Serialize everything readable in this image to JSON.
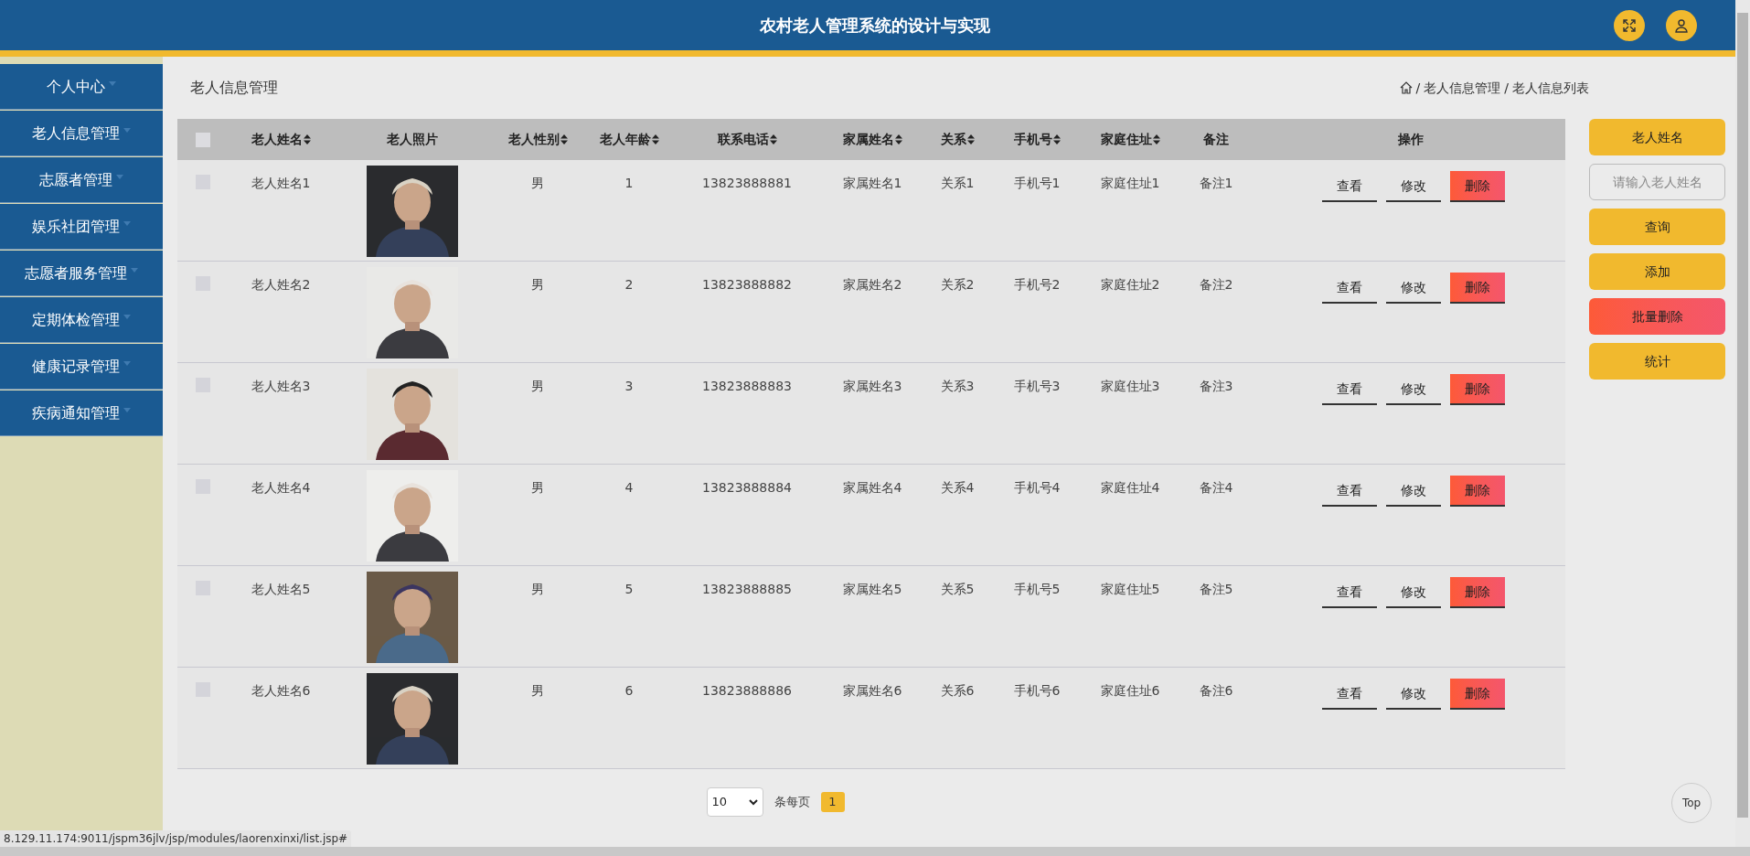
{
  "header": {
    "title": "农村老人管理系统的设计与实现"
  },
  "sidebar": {
    "items": [
      {
        "label": "个人中心"
      },
      {
        "label": "老人信息管理"
      },
      {
        "label": "志愿者管理"
      },
      {
        "label": "娱乐社团管理"
      },
      {
        "label": "志愿者服务管理"
      },
      {
        "label": "定期体检管理"
      },
      {
        "label": "健康记录管理"
      },
      {
        "label": "疾病通知管理"
      }
    ]
  },
  "page_title": "老人信息管理",
  "breadcrumb": [
    {
      "separator": "/",
      "label": "老人信息管理"
    },
    {
      "separator": "/",
      "label": "老人信息列表"
    }
  ],
  "table": {
    "all_checked": false,
    "columns": [
      {
        "label": "老人姓名",
        "sortable": true
      },
      {
        "label": "老人照片",
        "sortable": false
      },
      {
        "label": "老人性别",
        "sortable": true
      },
      {
        "label": "老人年龄",
        "sortable": true
      },
      {
        "label": "联系电话",
        "sortable": true
      },
      {
        "label": "家属姓名",
        "sortable": true
      },
      {
        "label": "关系",
        "sortable": true
      },
      {
        "label": "手机号",
        "sortable": true
      },
      {
        "label": "家庭住址",
        "sortable": true
      },
      {
        "label": "备注",
        "sortable": false
      },
      {
        "label": "操作",
        "sortable": false
      }
    ],
    "rows": [
      {
        "checked": false,
        "name": "老人姓名1",
        "photo": {
          "kind": "picture"
        },
        "gender": "男",
        "age": "1",
        "phone": "13823888881",
        "family": "家属姓名1",
        "relation": "关系1",
        "mobile": "手机号1",
        "address": "家庭住址1",
        "note": "备注1",
        "actions": [
          {
            "label": "查看",
            "kind": "plain"
          },
          {
            "label": "修改",
            "kind": "plain"
          },
          {
            "label": "删除",
            "kind": "danger"
          }
        ]
      },
      {
        "checked": false,
        "name": "老人姓名2",
        "photo": {
          "kind": "picture"
        },
        "gender": "男",
        "age": "2",
        "phone": "13823888882",
        "family": "家属姓名2",
        "relation": "关系2",
        "mobile": "手机号2",
        "address": "家庭住址2",
        "note": "备注2",
        "actions": [
          {
            "label": "查看",
            "kind": "plain"
          },
          {
            "label": "修改",
            "kind": "plain"
          },
          {
            "label": "删除",
            "kind": "danger"
          }
        ]
      },
      {
        "checked": false,
        "name": "老人姓名3",
        "photo": {
          "kind": "picture"
        },
        "gender": "男",
        "age": "3",
        "phone": "13823888883",
        "family": "家属姓名3",
        "relation": "关系3",
        "mobile": "手机号3",
        "address": "家庭住址3",
        "note": "备注3",
        "actions": [
          {
            "label": "查看",
            "kind": "plain"
          },
          {
            "label": "修改",
            "kind": "plain"
          },
          {
            "label": "删除",
            "kind": "danger"
          }
        ]
      },
      {
        "checked": false,
        "name": "老人姓名4",
        "photo": {
          "kind": "picture"
        },
        "gender": "男",
        "age": "4",
        "phone": "13823888884",
        "family": "家属姓名4",
        "relation": "关系4",
        "mobile": "手机号4",
        "address": "家庭住址4",
        "note": "备注4",
        "actions": [
          {
            "label": "查看",
            "kind": "plain"
          },
          {
            "label": "修改",
            "kind": "plain"
          },
          {
            "label": "删除",
            "kind": "danger"
          }
        ]
      },
      {
        "checked": false,
        "name": "老人姓名5",
        "photo": {
          "kind": "picture"
        },
        "gender": "男",
        "age": "5",
        "phone": "13823888885",
        "family": "家属姓名5",
        "relation": "关系5",
        "mobile": "手机号5",
        "address": "家庭住址5",
        "note": "备注5",
        "actions": [
          {
            "label": "查看",
            "kind": "plain"
          },
          {
            "label": "修改",
            "kind": "plain"
          },
          {
            "label": "删除",
            "kind": "danger"
          }
        ]
      },
      {
        "checked": false,
        "name": "老人姓名6",
        "photo": {
          "kind": "picture"
        },
        "gender": "男",
        "age": "6",
        "phone": "13823888886",
        "family": "家属姓名6",
        "relation": "关系6",
        "mobile": "手机号6",
        "address": "家庭住址6",
        "note": "备注6",
        "actions": [
          {
            "label": "查看",
            "kind": "plain"
          },
          {
            "label": "修改",
            "kind": "plain"
          },
          {
            "label": "删除",
            "kind": "danger"
          }
        ]
      }
    ]
  },
  "search_panel": {
    "label": "老人姓名",
    "placeholder": "请输入老人姓名",
    "buttons": [
      {
        "label": "查询",
        "kind": "primary"
      },
      {
        "label": "添加",
        "kind": "primary"
      },
      {
        "label": "批量删除",
        "kind": "danger"
      },
      {
        "label": "统计",
        "kind": "primary"
      }
    ]
  },
  "pagination": {
    "page_size": "10",
    "per_page_label": "条每页",
    "pages": [
      {
        "label": "1",
        "selected": true
      }
    ]
  },
  "back_to_top": "Top",
  "status_url": "8.129.11.174:9011/jspm36jlv/jsp/modules/laorenxinxi/list.jsp#"
}
